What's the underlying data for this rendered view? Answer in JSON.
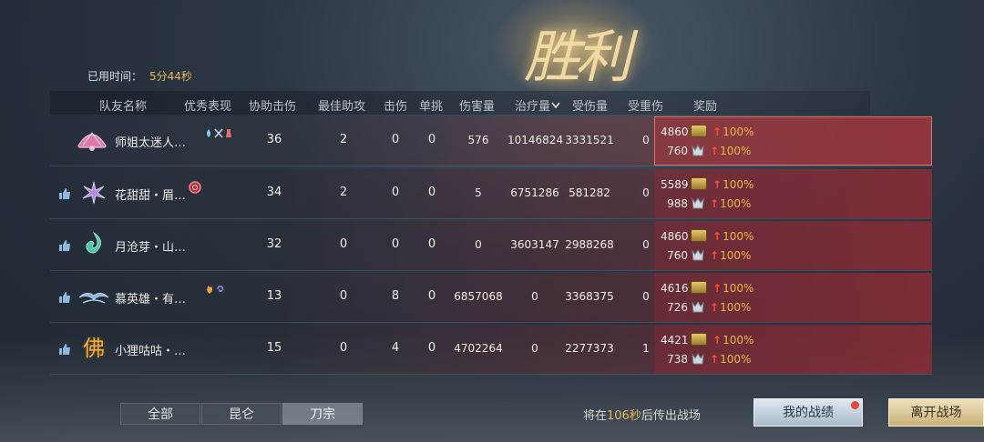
{
  "victory_title": "胜利",
  "elapsed": {
    "label": "已用时间：",
    "value": "5分44秒"
  },
  "headers": [
    "队友名称",
    "优秀表现",
    "协助击伤",
    "最佳助攻",
    "击伤",
    "单挑",
    "伤害量",
    "治疗量",
    "受伤量",
    "受重伤",
    "奖励"
  ],
  "sort_indicator": "chevron-down-icon",
  "players": [
    {
      "name": "师姐太迷人…",
      "liked": false,
      "assists": "36",
      "best_assist": "2",
      "kills": "0",
      "duels": "0",
      "damage": "576",
      "healing": "10146824",
      "taken": "3331521",
      "downed": "0",
      "coins": "4860",
      "coin_pct": "100%",
      "crystals": "760",
      "crystal_pct": "100%",
      "avatar": "fan-emblem-icon",
      "perf_icons": [
        "drop-icon",
        "swords-icon",
        "flask-icon"
      ]
    },
    {
      "name": "花甜甜・眉…",
      "liked": true,
      "assists": "34",
      "best_assist": "2",
      "kills": "0",
      "duels": "0",
      "damage": "5",
      "healing": "6751286",
      "taken": "581282",
      "downed": "0",
      "coins": "5589",
      "coin_pct": "100%",
      "crystals": "988",
      "crystal_pct": "100%",
      "avatar": "lotus-emblem-icon",
      "perf_icons": [
        "ring-badge-icon"
      ]
    },
    {
      "name": "月沧芽・山…",
      "liked": true,
      "assists": "32",
      "best_assist": "0",
      "kills": "0",
      "duels": "0",
      "damage": "0",
      "healing": "3603147",
      "taken": "2988268",
      "downed": "0",
      "coins": "4860",
      "coin_pct": "100%",
      "crystals": "760",
      "crystal_pct": "100%",
      "avatar": "jade-emblem-icon",
      "perf_icons": []
    },
    {
      "name": "慕英雄・有…",
      "liked": true,
      "assists": "13",
      "best_assist": "0",
      "kills": "8",
      "duels": "0",
      "damage": "6857068",
      "healing": "0",
      "taken": "3368375",
      "downed": "0",
      "coins": "4616",
      "coin_pct": "100%",
      "crystals": "726",
      "crystal_pct": "100%",
      "avatar": "cloud-emblem-icon",
      "perf_icons": [
        "flame-icon",
        "swirl-icon"
      ]
    },
    {
      "name": "小狸咕咕・…",
      "liked": true,
      "assists": "15",
      "best_assist": "0",
      "kills": "4",
      "duels": "0",
      "damage": "4702264",
      "healing": "0",
      "taken": "2277373",
      "downed": "1",
      "coins": "4421",
      "coin_pct": "100%",
      "crystals": "738",
      "crystal_pct": "100%",
      "avatar": "buddha-emblem-icon",
      "perf_icons": []
    }
  ],
  "avatar_glyph_5": "佛",
  "tabs": [
    {
      "label": "全部",
      "active": false
    },
    {
      "label": "昆仑",
      "active": false
    },
    {
      "label": "刀宗",
      "active": true
    }
  ],
  "exit": {
    "prefix": "将在",
    "seconds": "106秒",
    "suffix": "后传出战场"
  },
  "buttons": {
    "my_record": "我的战绩",
    "leave": "离开战场"
  },
  "colors": {
    "accent_gold": "#e4b85c",
    "reward_red": "#a02832",
    "arrow_red": "#ff4b3d"
  }
}
